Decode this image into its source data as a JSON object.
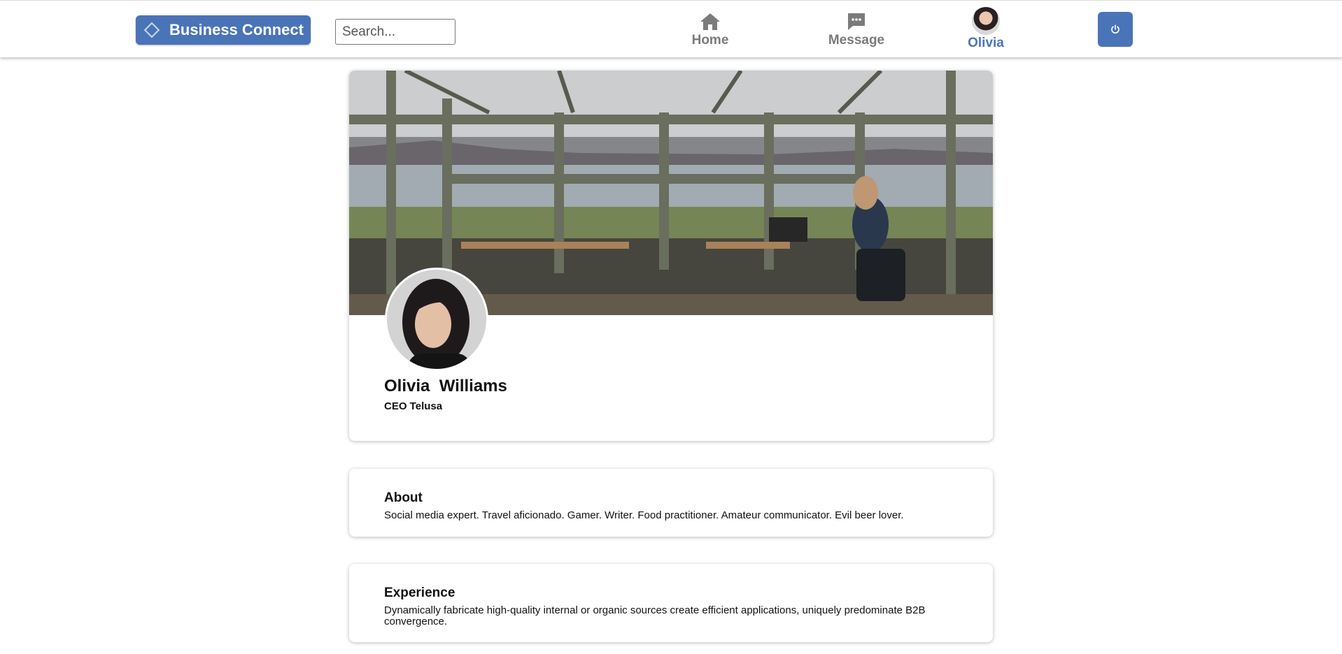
{
  "header": {
    "brand": "Business Connect",
    "search_placeholder": "Search...",
    "nav": [
      {
        "label": "Home",
        "icon": "home-icon"
      },
      {
        "label": "Message",
        "icon": "message-icon"
      },
      {
        "label": "Olivia",
        "icon": "avatar"
      }
    ],
    "power_icon": "power-icon"
  },
  "profile": {
    "name": "Olivia  Williams",
    "headline": "CEO Telusa"
  },
  "about": {
    "title": "About",
    "text": "Social media expert. Travel aficionado. Gamer. Writer. Food practitioner. Amateur communicator. Evil beer lover."
  },
  "experience": {
    "title": "Experience",
    "text": "Dynamically fabricate high-quality internal or organic sources create efficient applications, uniquely predominate B2B convergence."
  },
  "colors": {
    "accent": "#4a74b8",
    "nav_inactive": "#7b7b7b"
  }
}
